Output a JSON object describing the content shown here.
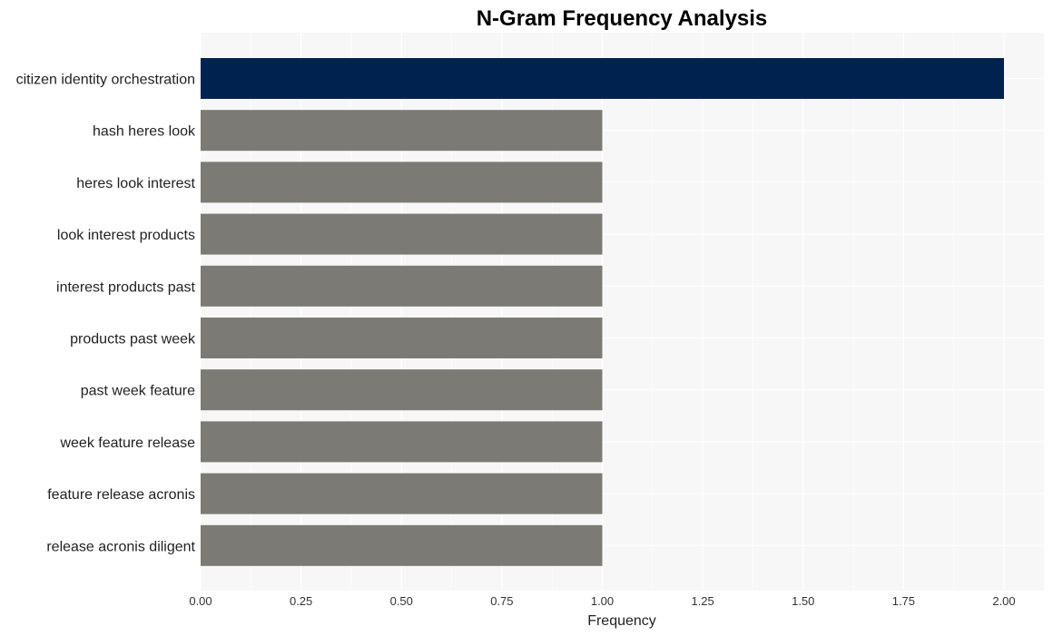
{
  "chart_data": {
    "type": "bar",
    "orientation": "horizontal",
    "title": "N-Gram Frequency Analysis",
    "xlabel": "Frequency",
    "ylabel": "",
    "xlim": [
      0,
      2.1
    ],
    "xticks": [
      "0.00",
      "0.25",
      "0.50",
      "0.75",
      "1.00",
      "1.25",
      "1.50",
      "1.75",
      "2.00"
    ],
    "xtick_values": [
      0,
      0.25,
      0.5,
      0.75,
      1.0,
      1.25,
      1.5,
      1.75,
      2.0
    ],
    "grid": true,
    "categories": [
      "citizen identity orchestration",
      "hash heres look",
      "heres look interest",
      "look interest products",
      "interest products past",
      "products past week",
      "past week feature",
      "week feature release",
      "feature release acronis",
      "release acronis diligent"
    ],
    "values": [
      2,
      1,
      1,
      1,
      1,
      1,
      1,
      1,
      1,
      1
    ],
    "colors": {
      "highlight": "#00224e",
      "default": "#7b7a75",
      "panel_background": "#f7f7f7",
      "grid": "#ffffff"
    }
  }
}
